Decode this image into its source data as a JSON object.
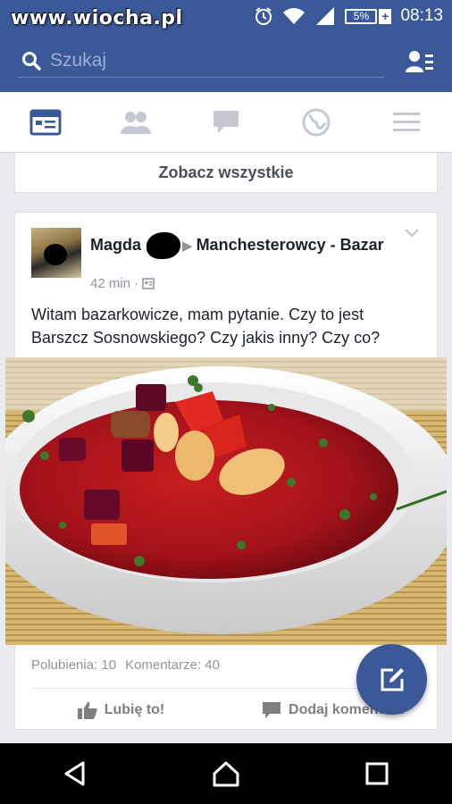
{
  "status_bar": {
    "watermark": "www.wiocha.pl",
    "battery": "5%",
    "battery_plus": "+",
    "time": "08:13"
  },
  "search": {
    "placeholder": "Szukaj"
  },
  "tabs": [
    {
      "icon": "news-feed-icon",
      "active": true
    },
    {
      "icon": "friends-icon",
      "active": false
    },
    {
      "icon": "messages-icon",
      "active": false
    },
    {
      "icon": "notifications-globe-icon",
      "active": false
    },
    {
      "icon": "menu-icon",
      "active": false
    }
  ],
  "see_all": {
    "label": "Zobacz wszystkie"
  },
  "post": {
    "author": "Magda",
    "arrow": "▶",
    "group": "Manchesterowcy - Bazar",
    "time": "42 min",
    "separator": "·",
    "text": "Witam bazarkowicze, mam pytanie. Czy to jest Barszcz Sosnowskiego? Czy jakis inny? Czy co?",
    "likes": "Polubienia: 10",
    "comments": "Komentarze: 40",
    "like_label": "Lubię to!",
    "comment_label": "Dodaj komentarz"
  },
  "colors": {
    "brand": "#3b5998",
    "background": "#e9ebee",
    "soup": "#b3161b"
  }
}
